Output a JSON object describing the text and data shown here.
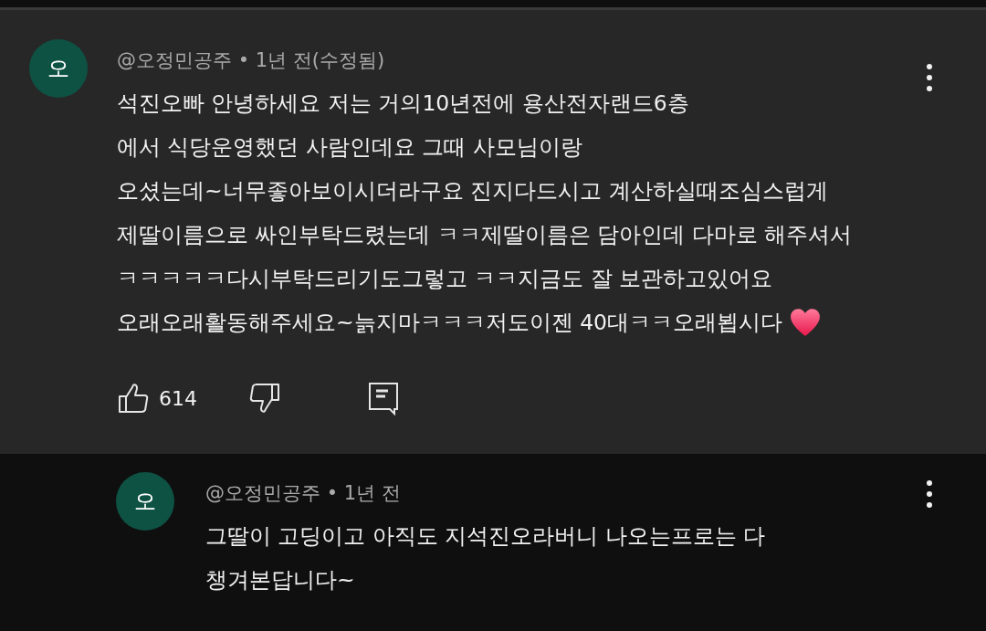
{
  "comments": [
    {
      "avatar": "오",
      "author": "@오정민공주",
      "separator": "•",
      "time": "1년 전(수정됨)",
      "lines": [
        "석진오빠 안녕하세요 저는 거의10년전에 용산전자랜드6층",
        "에서 식당운영했던 사람인데요 그때 사모님이랑",
        "오셨는데~너무좋아보이시더라구요 진지다드시고 계산하실때조심스럽게",
        "제딸이름으로 싸인부탁드렸는데 ㅋㅋ제딸이름은 담아인데 다마로 해주셔서",
        "ㅋㅋㅋㅋㅋ다시부탁드리기도그렇고 ㅋㅋ지금도 잘 보관하고있어요",
        "오래오래활동해주세요~늙지마ㅋㅋㅋ저도이젠 40대ㅋㅋ오래뵙시다"
      ],
      "heart": true,
      "likes": "614",
      "highlighted": true
    },
    {
      "avatar": "오",
      "author": "@오정민공주",
      "separator": "•",
      "time": "1년 전",
      "lines": [
        "그딸이 고딩이고 아직도 지석진오라버니 나오는프로는 다",
        "챙겨본답니다~"
      ],
      "heart": false,
      "highlighted": false
    }
  ]
}
